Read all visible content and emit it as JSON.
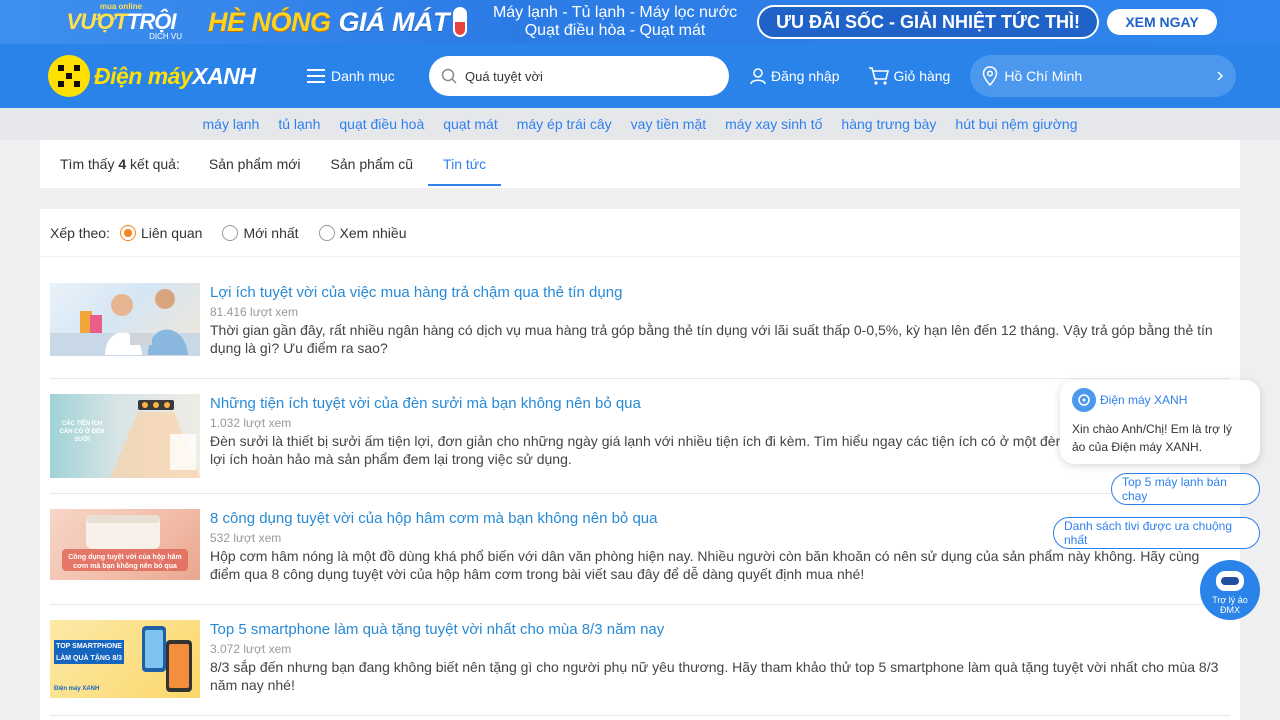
{
  "promo": {
    "logo_small": "mua online",
    "logo_big_1": "VƯỢT",
    "logo_big_2": "TRỘI",
    "logo_sub": "DỊCH VỤ",
    "heading_1": "HÈ NÓNG",
    "heading_2": "GIÁ MÁT",
    "products_line1": "Máy lạnh - Tủ lạnh - Máy lọc nước",
    "products_line2": "Quạt điều hòa - Quạt mát",
    "cta": "ƯU ĐÃI SỐC - GIẢI NHIỆT TỨC THÌ!",
    "button": "XEM NGAY"
  },
  "header": {
    "logo_text_1": "Điện máy",
    "logo_text_2": "XANH",
    "menu_label": "Danh mục",
    "search_value": "Quá tuyệt vời",
    "login_label": "Đăng nhập",
    "cart_label": "Giỏ hàng",
    "location": "Hồ Chí Minh"
  },
  "keywords": [
    "máy lạnh",
    "tủ lạnh",
    "quạt điều hoà",
    "quạt mát",
    "máy ép trái cây",
    "vay tiền mặt",
    "máy xay sinh tố",
    "hàng trưng bày",
    "hút bụi nệm giường"
  ],
  "tabs": {
    "found_prefix": "Tìm thấy",
    "found_count": "4",
    "found_suffix": "kết quả:",
    "items": [
      "Sản phẩm mới",
      "Sản phẩm cũ",
      "Tin tức"
    ],
    "active": "Tin tức"
  },
  "sort": {
    "label": "Xếp theo:",
    "options": [
      "Liên quan",
      "Mới nhất",
      "Xem nhiều"
    ],
    "selected": "Liên quan"
  },
  "articles": [
    {
      "title": "Lợi ích tuyệt vời của việc mua hàng trả chậm qua thẻ tín dụng",
      "views": "81.416 lượt xem",
      "desc": "Thời gian gần đây, rất nhiều ngân hàng có dịch vụ mua hàng trả góp bằng thẻ tín dụng với lãi suất thấp 0-0,5%, kỳ hạn lên đến 12 tháng. Vậy trả góp bằng thẻ tín dụng là gì? Ưu điểm ra sao?"
    },
    {
      "title": "Những tiện ích tuyệt vời của đèn sưởi mà bạn không nên bỏ qua",
      "views": "1.032 lượt xem",
      "desc": "Đèn sưởi là thiết bị sưởi ấm tiện lợi, đơn giản cho những ngày giá lạnh với nhiều tiện ích đi kèm. Tìm hiểu ngay các tiện ích có ở một đèn sưởi để khám phá những lợi ích hoàn hảo mà sản phẩm đem lại trong việc sử dụng.",
      "thumb_text": "CÁC TIỆN ÍCH CẦN CÓ Ở ĐÈN SƯỞI"
    },
    {
      "title": "8 công dụng tuyệt vời của hộp hâm cơm mà bạn không nên bỏ qua",
      "views": "532 lượt xem",
      "desc": "Hộp cơm hâm nóng là một đồ dùng khá phổ biến với dân văn phòng hiện nay. Nhiều người còn băn khoăn có nên sử dụng của sản phẩm này không. Hãy cùng điểm qua 8 công dụng tuyệt vời của hộp hâm cơm trong bài viết sau đây để dễ dàng quyết định mua nhé!",
      "thumb_text": "Công dụng tuyệt vời của hộp hâm cơm mà bạn không nên bỏ qua"
    },
    {
      "title": "Top 5 smartphone làm quà tặng tuyệt vời nhất cho mùa 8/3 năm nay",
      "views": "3.072 lượt xem",
      "desc": "8/3 sắp đến nhưng bạn đang không biết nên tặng gì cho người phụ nữ yêu thương. Hãy tham khảo thử top 5 smartphone làm quà tặng tuyệt vời nhất cho mùa 8/3 năm nay nhé!",
      "thumb_text_1": "TOP SMARTPHONE",
      "thumb_text_2": "LÀM QUÀ TẶNG 8/3",
      "thumb_logo": "Điện máy XANH"
    }
  ],
  "chat": {
    "brand": "Điện máy XANH",
    "message": "Xin chào Anh/Chị! Em là trợ lý ảo của Điện máy XANH.",
    "chips": [
      "Top 5 máy lạnh bán chạy",
      "Danh sách tivi được ưa chuộng nhất"
    ],
    "bot_label_1": "Trợ lý ảo",
    "bot_label_2": "ĐMX"
  },
  "colors": {
    "header_blue": "#2a83e9",
    "link_blue": "#288ad6",
    "radio_orange": "#f58220",
    "logo_yellow": "#ffe000"
  }
}
